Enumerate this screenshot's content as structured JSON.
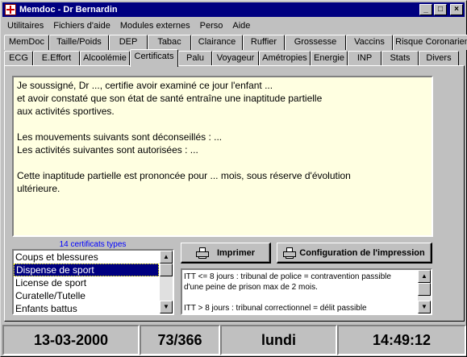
{
  "window": {
    "title": "Memdoc - Dr Bernardin"
  },
  "menubar": [
    "Utilitaires",
    "Fichiers d'aide",
    "Modules externes",
    "Perso",
    "Aide"
  ],
  "tabs_row1": [
    "MemDoc",
    "Taille/Poids",
    "DEP",
    "Tabac",
    "Clairance",
    "Ruffier",
    "Grossesse",
    "Vaccins",
    "Risque Coronarien"
  ],
  "tabs_row2": [
    "ECG",
    "E.Effort",
    "Alcoolémie",
    "Certificats",
    "Palu",
    "Voyageur",
    "Amétropies",
    "Energie",
    "INP",
    "Stats",
    "Divers"
  ],
  "active_tab": "Certificats",
  "certificate_text": [
    "Je soussigné, Dr ..., certifie avoir examiné ce jour l'enfant ...",
    "et avoir constaté que son état de santé entraîne une inaptitude partielle",
    "aux activités sportives.",
    "",
    "Les mouvements suivants sont déconseillés : ...",
    "Les activités suivantes sont autorisées : ...",
    "",
    "Cette inaptitude partielle est prononcée pour ... mois, sous réserve d'évolution",
    "ultérieure."
  ],
  "certificate_count_label": "14 certificats types",
  "certificate_list": [
    {
      "label": "Coups et blessures",
      "selected": false
    },
    {
      "label": "Dispense de sport",
      "selected": true
    },
    {
      "label": "License de sport",
      "selected": false
    },
    {
      "label": "Curatelle/Tutelle",
      "selected": false
    },
    {
      "label": "Enfants battus",
      "selected": false
    }
  ],
  "buttons": {
    "print": "Imprimer",
    "print_config": "Configuration de l'impression"
  },
  "info_text": [
    "ITT <= 8 jours : tribunal de police = contravention passible",
    "d'une peine de prison max de 2 mois.",
    "",
    "ITT > 8 jours : tribunal correctionnel = délit passible"
  ],
  "statusbar": {
    "date": "13-03-2000",
    "day_of_year": "73/366",
    "weekday": "lundi",
    "time": "14:49:12"
  },
  "colors": {
    "titlebar": "#000080",
    "memo_background": "#ffffe1",
    "count_label": "#0000ff",
    "selection": "#000080"
  }
}
